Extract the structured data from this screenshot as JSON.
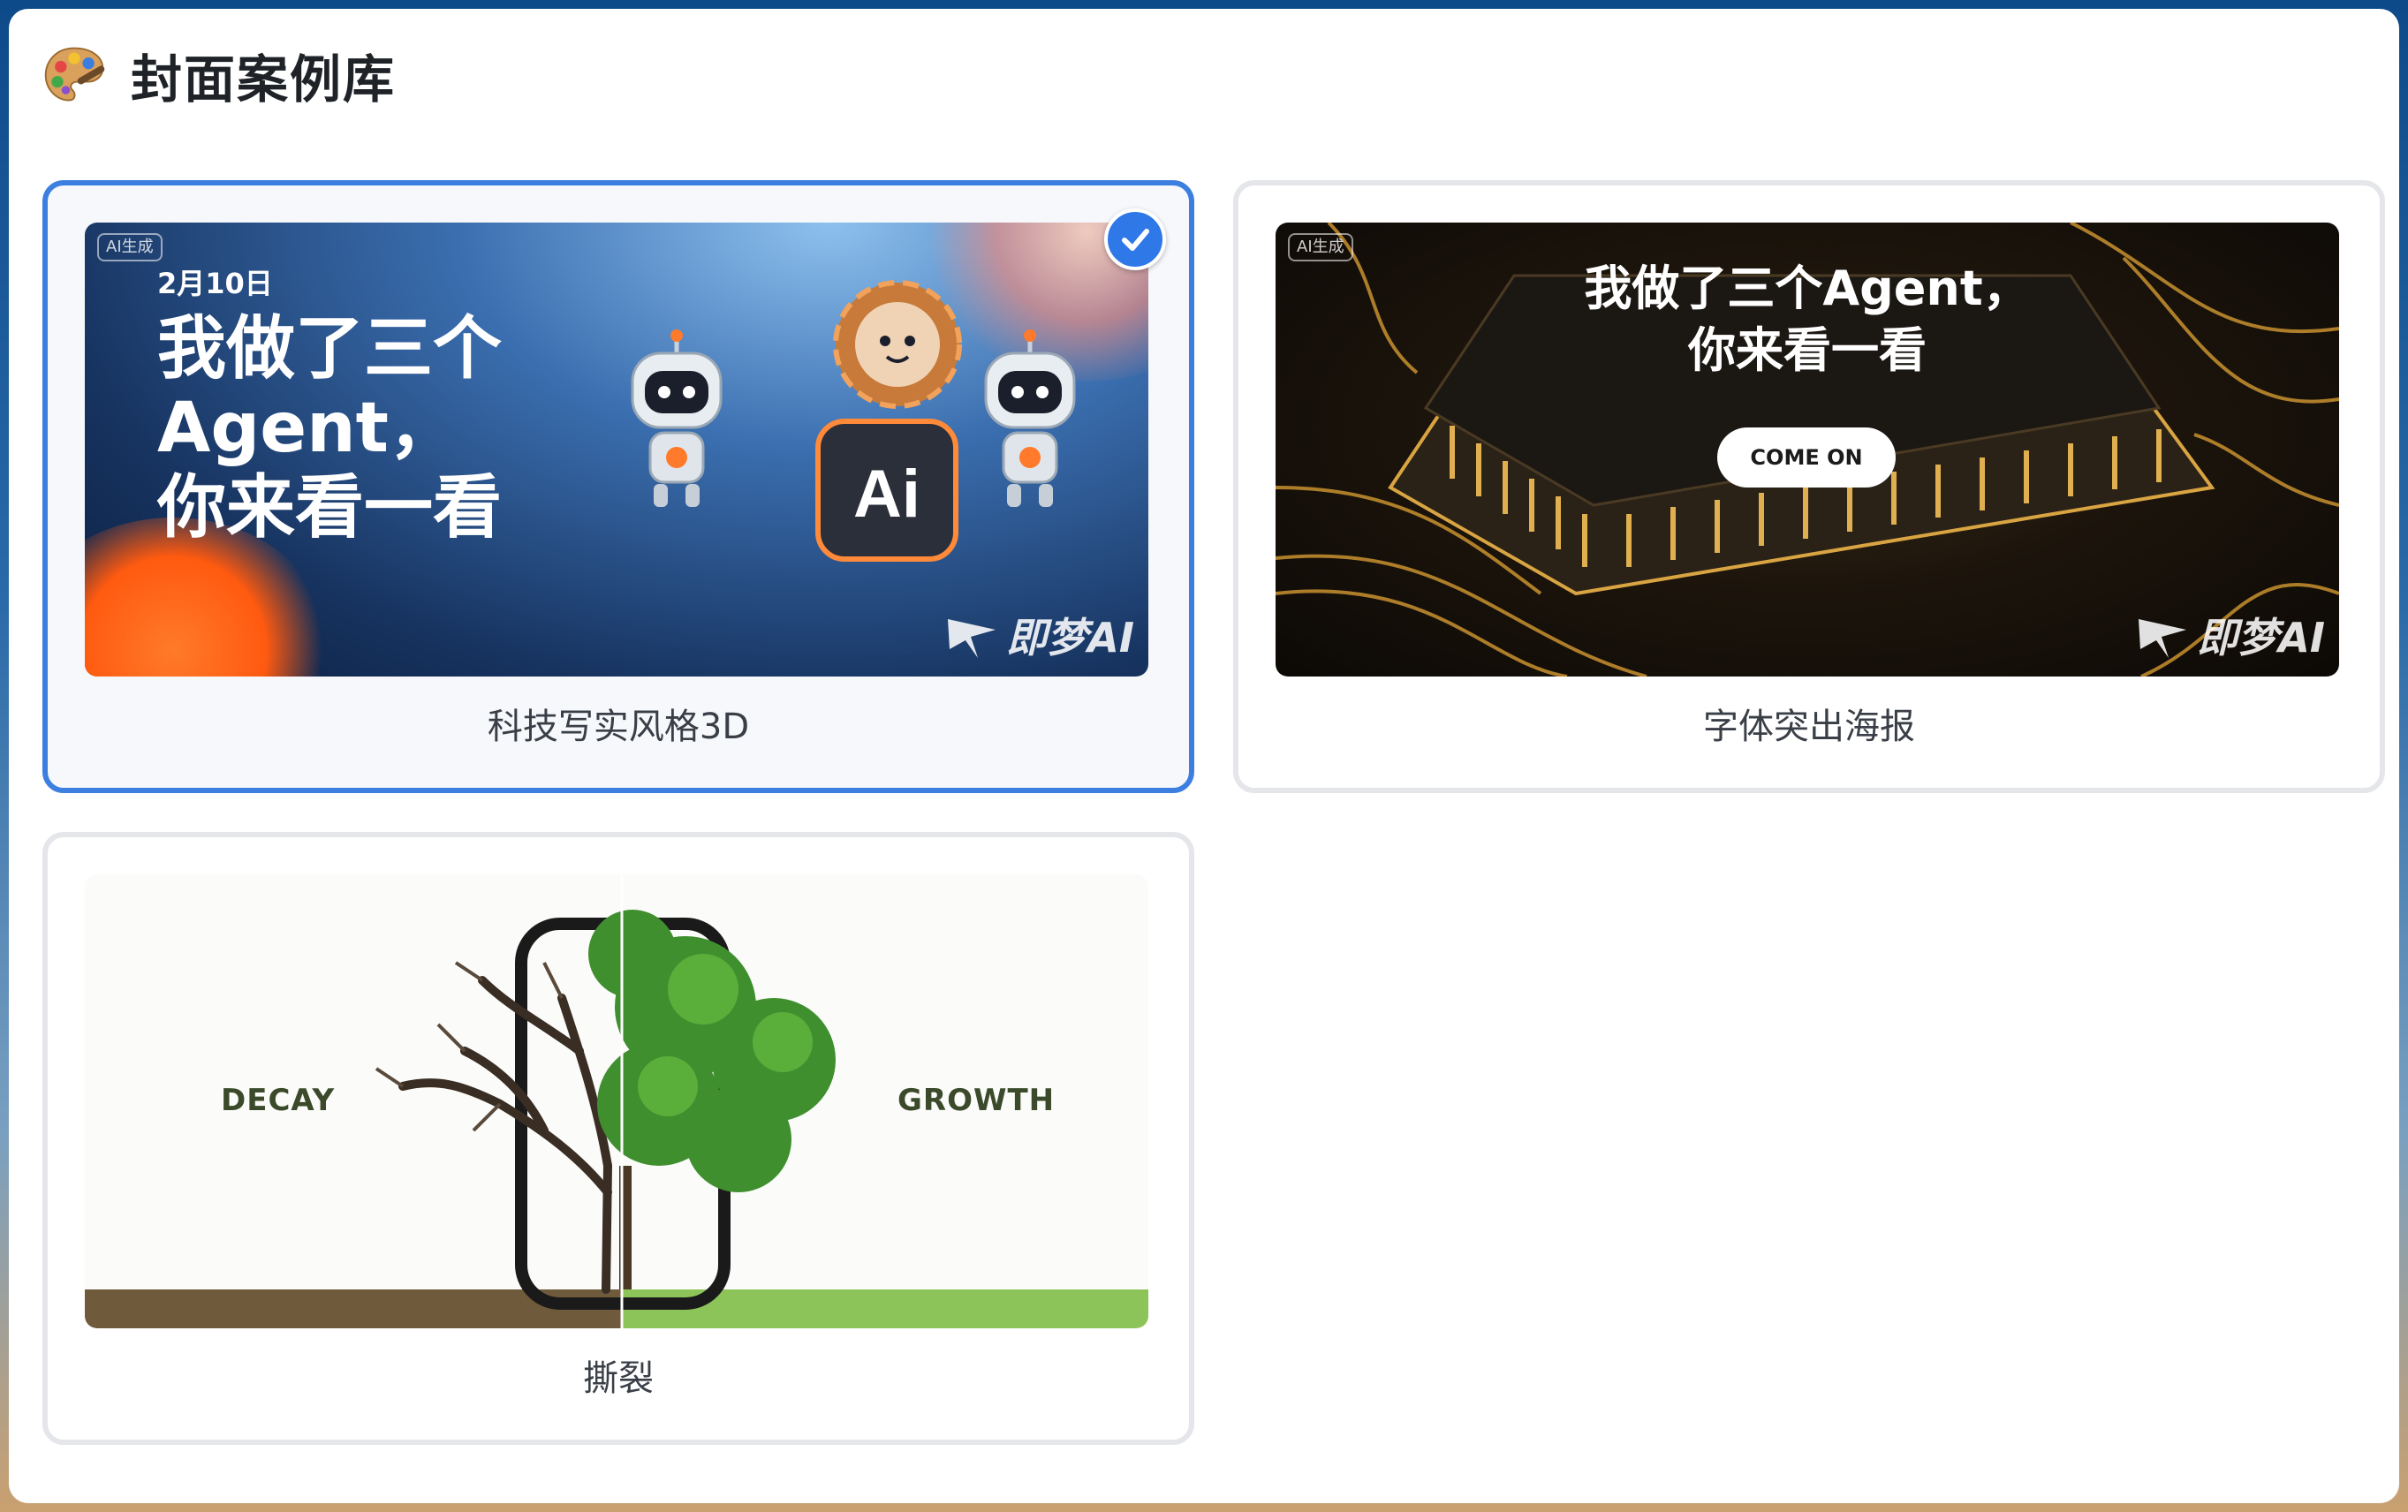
{
  "header": {
    "icon": "palette-icon",
    "title": "封面案例库"
  },
  "cards": [
    {
      "label": "科技写实风格3D",
      "selected": true,
      "thumbnail": {
        "ai_tag": "AI生成",
        "date": "2月10日",
        "headline_lines": [
          "我做了三个",
          "Agent，",
          "你来看一看"
        ],
        "badge_text": "Ai",
        "brand": "即梦AI"
      }
    },
    {
      "label": "字体突出海报",
      "selected": false,
      "thumbnail": {
        "ai_tag": "AI生成",
        "headline_lines": [
          "我做了三个Agent，",
          "你来看一看"
        ],
        "button_text": "COME ON",
        "brand": "即梦AI"
      }
    },
    {
      "label": "撕裂",
      "selected": false,
      "thumbnail": {
        "left_word": "DECAY",
        "right_word": "GROWTH"
      }
    }
  ],
  "colors": {
    "accent": "#3d7fe0",
    "check": "#2f78e8",
    "card_border": "#e4e6ea"
  }
}
